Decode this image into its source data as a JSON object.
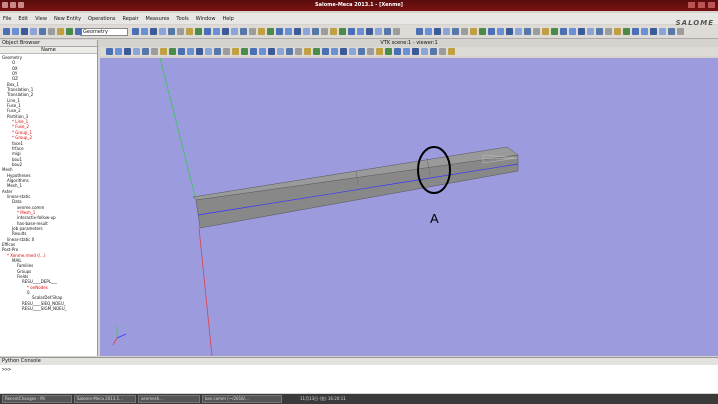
{
  "window": {
    "title": "Salome-Meca 2013.1 - [Xenme]"
  },
  "menu": [
    "File",
    "Edit",
    "View",
    "New Entity",
    "Operations",
    "Repair",
    "Measures",
    "Tools",
    "Window",
    "Help"
  ],
  "toolbar": {
    "module_combo": "Geometry",
    "logo": "SALOME"
  },
  "object_browser": {
    "title": "Object Browser",
    "column_header": "Name",
    "tree": [
      {
        "label": "Geometry",
        "indent": 0,
        "red": false
      },
      {
        "label": "O",
        "indent": 2,
        "red": false
      },
      {
        "label": "OX",
        "indent": 2,
        "red": false
      },
      {
        "label": "OY",
        "indent": 2,
        "red": false
      },
      {
        "label": "OZ",
        "indent": 2,
        "red": false
      },
      {
        "label": "Box_1",
        "indent": 1,
        "red": false
      },
      {
        "label": "Translation_1",
        "indent": 1,
        "red": false
      },
      {
        "label": "Translation_2",
        "indent": 1,
        "red": false
      },
      {
        "label": "Line_1",
        "indent": 1,
        "red": false
      },
      {
        "label": "Fuse_1",
        "indent": 1,
        "red": false
      },
      {
        "label": "Fuse_2",
        "indent": 1,
        "red": false
      },
      {
        "label": "Partition_3",
        "indent": 1,
        "red": false
      },
      {
        "label": "* Line_1",
        "indent": 2,
        "red": true
      },
      {
        "label": "* Fuse_2",
        "indent": 2,
        "red": true
      },
      {
        "label": "* Group_1",
        "indent": 2,
        "red": true
      },
      {
        "label": "* Group_2",
        "indent": 2,
        "red": true
      },
      {
        "label": "face1",
        "indent": 2,
        "red": false
      },
      {
        "label": "frface",
        "indent": 2,
        "red": false
      },
      {
        "label": "migi",
        "indent": 2,
        "red": false
      },
      {
        "label": "bou1",
        "indent": 2,
        "red": false
      },
      {
        "label": "bou2",
        "indent": 2,
        "red": false
      },
      {
        "label": "Mesh",
        "indent": 0,
        "red": false
      },
      {
        "label": "Hypotheses",
        "indent": 1,
        "red": false
      },
      {
        "label": "Algorithms",
        "indent": 1,
        "red": false
      },
      {
        "label": "Mesh_1",
        "indent": 1,
        "red": false
      },
      {
        "label": "Aster",
        "indent": 0,
        "red": false
      },
      {
        "label": "linear-static",
        "indent": 1,
        "red": false
      },
      {
        "label": "Data",
        "indent": 2,
        "red": false
      },
      {
        "label": "xenme.comm",
        "indent": 3,
        "red": false
      },
      {
        "label": "* Mesh_1",
        "indent": 3,
        "red": true
      },
      {
        "label": "interactiv-follow-up",
        "indent": 3,
        "red": false
      },
      {
        "label": "has-base-result",
        "indent": 3,
        "red": false
      },
      {
        "label": "Job parameters",
        "indent": 2,
        "red": false
      },
      {
        "label": "Results",
        "indent": 2,
        "red": false
      },
      {
        "label": "linear-static 0",
        "indent": 1,
        "red": false
      },
      {
        "label": "Efficas",
        "indent": 0,
        "red": false
      },
      {
        "label": "Post-Pro",
        "indent": 0,
        "red": false
      },
      {
        "label": "* Xenme.rmed (/...)",
        "indent": 1,
        "red": true
      },
      {
        "label": "MAIL",
        "indent": 2,
        "red": false
      },
      {
        "label": "Families",
        "indent": 3,
        "red": false
      },
      {
        "label": "Groups",
        "indent": 3,
        "red": false
      },
      {
        "label": "Fields",
        "indent": 3,
        "red": false
      },
      {
        "label": "RESU____DEPL___",
        "indent": 4,
        "red": false
      },
      {
        "label": "* onNodes",
        "indent": 5,
        "red": true
      },
      {
        "label": "0.",
        "indent": 5,
        "red": false
      },
      {
        "label": "ScalarDef.Shap",
        "indent": 6,
        "red": false
      },
      {
        "label": "RESU____SIEQ_NOEU_",
        "indent": 4,
        "red": false
      },
      {
        "label": "RESU____SIGM_NOEU_",
        "indent": 4,
        "red": false
      }
    ]
  },
  "viewer": {
    "title": "VTK scene:1 - viewer:1"
  },
  "annotation": {
    "label": "A"
  },
  "python_console": {
    "title": "Python Console",
    "prompt": ">>>"
  },
  "taskbar": {
    "items": [
      "RecentChanges - Mi",
      "Salome-Meca 2013.1...",
      "xenmesh...",
      "kan.comm (~/2016/..."
    ],
    "clock": "11月13日 (金) 16:20:11"
  },
  "colors": {
    "titlebar": "#6a1010",
    "viewport": "#9b9bde",
    "beam_face": "#888888",
    "beam_top": "#9a9a9a",
    "axis_green": "#3ec55a",
    "axis_red": "#e0404c",
    "edge_blue": "#3333ff"
  }
}
